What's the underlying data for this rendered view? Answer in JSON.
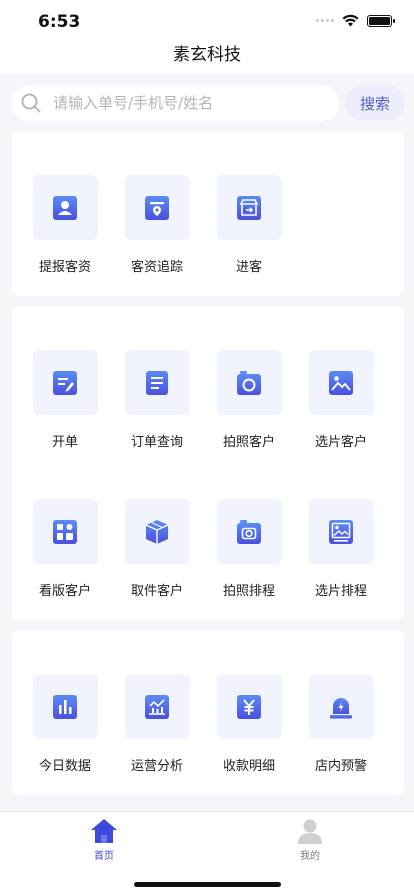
{
  "status": {
    "time": "6:53"
  },
  "header": {
    "title": "素玄科技"
  },
  "search": {
    "placeholder": "请输入单号/手机号/姓名",
    "button_label": "搜索"
  },
  "section1": {
    "items": [
      {
        "label": "提报客资",
        "icon": "user-card-icon"
      },
      {
        "label": "客资追踪",
        "icon": "location-tracking-icon"
      },
      {
        "label": "进客",
        "icon": "store-enter-icon"
      }
    ]
  },
  "section2": {
    "items": [
      {
        "label": "开单",
        "icon": "edit-order-icon"
      },
      {
        "label": "订单查询",
        "icon": "document-list-icon"
      },
      {
        "label": "拍照客户",
        "icon": "camera-icon"
      },
      {
        "label": "选片客户",
        "icon": "photo-image-icon"
      },
      {
        "label": "看版客户",
        "icon": "layout-grid-icon"
      },
      {
        "label": "取件客户",
        "icon": "package-box-icon"
      },
      {
        "label": "拍照排程",
        "icon": "camera-schedule-icon"
      },
      {
        "label": "选片排程",
        "icon": "photo-schedule-icon"
      }
    ]
  },
  "section3": {
    "items": [
      {
        "label": "今日数据",
        "icon": "bar-chart-icon"
      },
      {
        "label": "运营分析",
        "icon": "analysis-chart-icon"
      },
      {
        "label": "收款明细",
        "icon": "yuan-icon"
      },
      {
        "label": "店内预警",
        "icon": "alarm-light-icon"
      }
    ]
  },
  "tabbar": {
    "tabs": [
      {
        "label": "首页",
        "icon": "home-icon",
        "active": true
      },
      {
        "label": "我的",
        "icon": "profile-icon",
        "active": false
      }
    ]
  },
  "colors": {
    "accent": "#4f5bd5",
    "tile_bg": "#f1f3fe",
    "active_tab": "#3d4adb",
    "inactive_tab": "#999999"
  }
}
